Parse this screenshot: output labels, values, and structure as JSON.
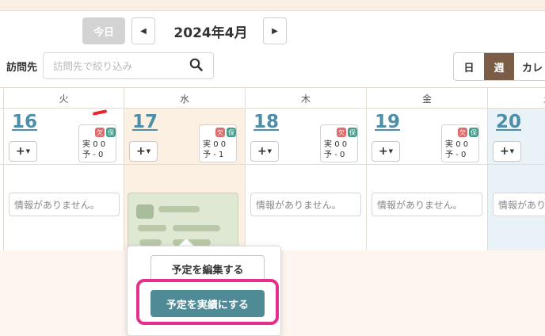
{
  "toolbar": {
    "today_label": "今日",
    "prev_icon": "▲",
    "next_icon": "▶",
    "month_title": "2024年4月",
    "visit_label": "訪問先",
    "search_placeholder": "訪問先で絞り込み",
    "view_tabs": [
      {
        "label": "日",
        "active": false
      },
      {
        "label": "週",
        "active": true
      },
      {
        "label": "カレ",
        "active": false
      }
    ]
  },
  "calendar": {
    "day_headers": [
      "火",
      "水",
      "木",
      "金",
      "土"
    ],
    "days": [
      {
        "date": "16",
        "absent_badge": "欠",
        "hold_badge": "保",
        "actual_label": "実",
        "actual_values": "0 0",
        "plan_label": "予",
        "plan_values": "- 0",
        "info": "情報がありません。",
        "today": false
      },
      {
        "date": "17",
        "absent_badge": "欠",
        "hold_badge": "保",
        "actual_label": "実",
        "actual_values": "0 0",
        "plan_label": "予",
        "plan_values": "- 1",
        "info": "",
        "today": true
      },
      {
        "date": "18",
        "absent_badge": "欠",
        "hold_badge": "保",
        "actual_label": "実",
        "actual_values": "0 0",
        "plan_label": "予",
        "plan_values": "- 0",
        "info": "情報がありません。",
        "today": false
      },
      {
        "date": "19",
        "absent_badge": "欠",
        "hold_badge": "保",
        "actual_label": "実",
        "actual_values": "0 0",
        "plan_label": "予",
        "plan_values": "- 0",
        "info": "情報がありません。",
        "today": false
      },
      {
        "date": "20",
        "info": "情報がありません。",
        "today": false
      }
    ],
    "add_label": "+"
  },
  "popover": {
    "edit_label": "予定を編集する",
    "result_label": "予定を実績にする"
  },
  "colors": {
    "accent_brown": "#7b5c47",
    "date_blue": "#4f8ea8",
    "result_teal": "#4e8b97",
    "highlight_pink": "#e62f8d",
    "absent_red": "#e06b6b",
    "hold_green": "#4a9b8a"
  }
}
